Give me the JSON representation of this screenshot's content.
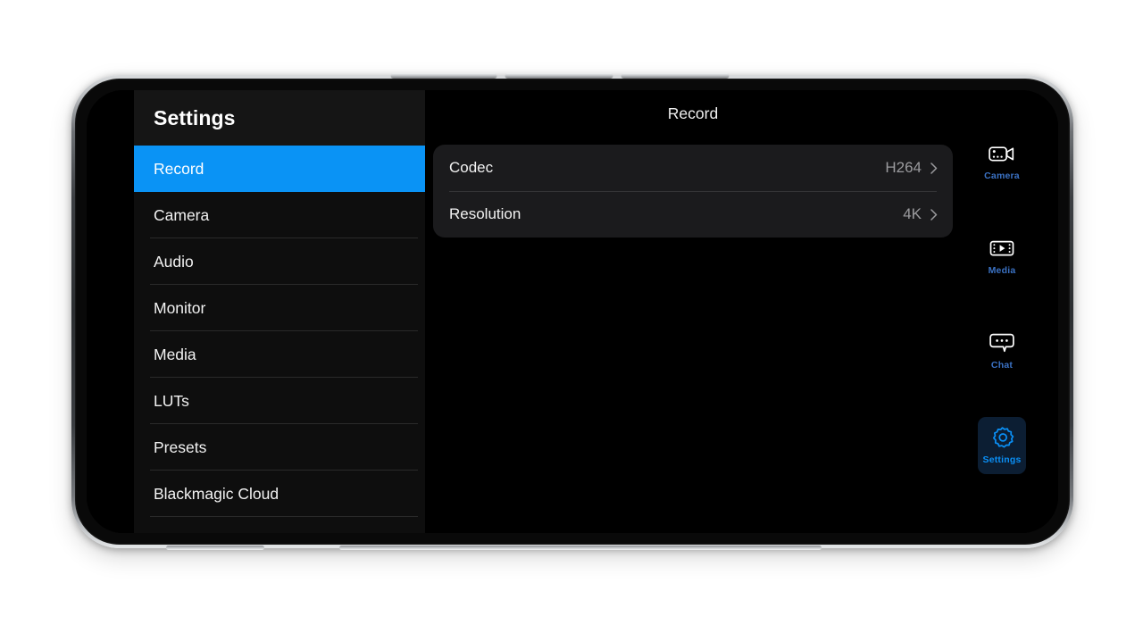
{
  "device": {
    "type": "smartphone-landscape",
    "frame_color": "#3c3f43"
  },
  "app": {
    "accent_color": "#0a93f5",
    "background_color": "#000000"
  },
  "sidebar": {
    "title": "Settings",
    "background_color": "#0e0e0e",
    "items": [
      {
        "label": "Record",
        "active": true
      },
      {
        "label": "Camera",
        "active": false
      },
      {
        "label": "Audio",
        "active": false
      },
      {
        "label": "Monitor",
        "active": false
      },
      {
        "label": "Media",
        "active": false
      },
      {
        "label": "LUTs",
        "active": false
      },
      {
        "label": "Presets",
        "active": false
      },
      {
        "label": "Blackmagic Cloud",
        "active": false
      }
    ]
  },
  "content": {
    "title": "Record",
    "card_color": "#1b1b1d",
    "rows": [
      {
        "label": "Codec",
        "value": "H264",
        "chevron": "chevron-right-icon"
      },
      {
        "label": "Resolution",
        "value": "4K",
        "chevron": "chevron-right-icon"
      }
    ]
  },
  "rail": {
    "label_color": "#3b72c4",
    "active_label_color": "#0a8ff5",
    "active_background_color": "#0c1e33",
    "items": [
      {
        "label": "Camera",
        "icon": "video-camera-icon",
        "active": false
      },
      {
        "label": "Media",
        "icon": "film-strip-play-icon",
        "active": false
      },
      {
        "label": "Chat",
        "icon": "speech-bubble-icon",
        "active": false
      },
      {
        "label": "Settings",
        "icon": "gear-icon",
        "active": true
      }
    ]
  }
}
